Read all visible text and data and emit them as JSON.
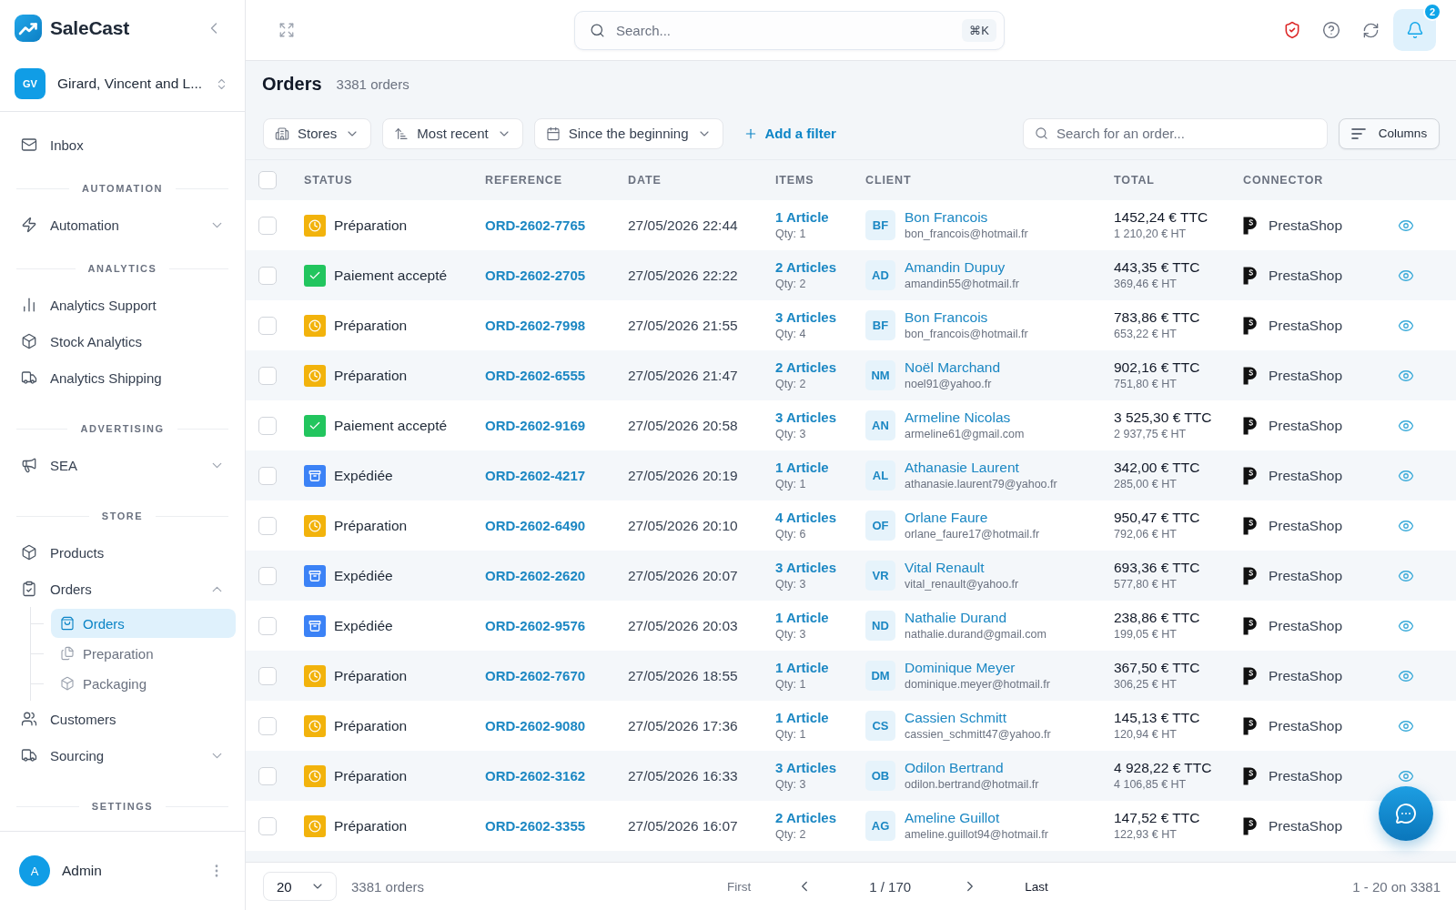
{
  "sidebar": {
    "brand": "SaleCast",
    "workspace": {
      "initials": "GV",
      "name": "Girard, Vincent and L..."
    },
    "top_items": [
      {
        "label": "Inbox",
        "selected": false
      }
    ],
    "sections": [
      {
        "title": "AUTOMATION",
        "items": [
          {
            "label": "Automation",
            "selected": false,
            "expanded": false
          }
        ]
      },
      {
        "title": "ANALYTICS",
        "items": [
          {
            "label": "Analytics Support",
            "selected": false
          },
          {
            "label": "Stock Analytics",
            "selected": false
          },
          {
            "label": "Analytics Shipping",
            "selected": false
          }
        ]
      },
      {
        "title": "ADVERTISING",
        "items": [
          {
            "label": "SEA",
            "selected": false,
            "expanded": false
          }
        ]
      },
      {
        "title": "STORE",
        "items": [
          {
            "label": "Products",
            "selected": false
          },
          {
            "label": "Orders",
            "selected": false,
            "expanded": true,
            "children": [
              {
                "label": "Orders",
                "selected": true
              },
              {
                "label": "Preparation",
                "selected": false
              },
              {
                "label": "Packaging",
                "selected": false
              }
            ]
          },
          {
            "label": "Customers",
            "selected": false
          },
          {
            "label": "Sourcing",
            "selected": false,
            "expanded": false
          }
        ]
      },
      {
        "title": "SETTINGS"
      }
    ],
    "user": {
      "initials": "A",
      "name": "Admin"
    }
  },
  "topbar": {
    "search": {
      "placeholder": "Search...",
      "shortcut": "⌘K"
    },
    "notifications": {
      "count": "2"
    }
  },
  "page": {
    "title": "Orders",
    "count": "3381 orders"
  },
  "filters": {
    "buttons": [
      {
        "label": "Stores"
      },
      {
        "label": "Most recent"
      },
      {
        "label": "Since the beginning"
      }
    ],
    "add_filter": "Add a filter",
    "search": {
      "placeholder": "Search for an order..."
    },
    "columns_button": "Columns"
  },
  "table": {
    "select_all": {
      "checked": false
    },
    "columns": [
      "STATUS",
      "REFERENCE",
      "DATE",
      "ITEMS",
      "CLIENT",
      "TOTAL",
      "CONNECTOR"
    ],
    "rows": [
      {
        "checked": false,
        "status": {
          "kind": "preparation",
          "label": "Préparation"
        },
        "reference": "ORD-2602-7765",
        "date": "27/05/2026 22:44",
        "items": "1 Article",
        "qty": "Qty: 1",
        "client": {
          "initials": "BF",
          "name": "Bon Francois",
          "email": "bon_francois@hotmail.fr"
        },
        "total_ttc": "1452,24 € TTC",
        "total_ht": "1 210,20 € HT",
        "connector": "PrestaShop"
      },
      {
        "checked": false,
        "status": {
          "kind": "paid",
          "label": "Paiement accepté"
        },
        "reference": "ORD-2602-2705",
        "date": "27/05/2026 22:22",
        "items": "2 Articles",
        "qty": "Qty: 2",
        "client": {
          "initials": "AD",
          "name": "Amandin Dupuy",
          "email": "amandin55@hotmail.fr"
        },
        "total_ttc": "443,35 € TTC",
        "total_ht": "369,46 € HT",
        "connector": "PrestaShop"
      },
      {
        "checked": false,
        "status": {
          "kind": "preparation",
          "label": "Préparation"
        },
        "reference": "ORD-2602-7998",
        "date": "27/05/2026 21:55",
        "items": "3 Articles",
        "qty": "Qty: 4",
        "client": {
          "initials": "BF",
          "name": "Bon Francois",
          "email": "bon_francois@hotmail.fr"
        },
        "total_ttc": "783,86 € TTC",
        "total_ht": "653,22 € HT",
        "connector": "PrestaShop"
      },
      {
        "checked": false,
        "status": {
          "kind": "preparation",
          "label": "Préparation"
        },
        "reference": "ORD-2602-6555",
        "date": "27/05/2026 21:47",
        "items": "2 Articles",
        "qty": "Qty: 2",
        "client": {
          "initials": "NM",
          "name": "Noël Marchand",
          "email": "noel91@yahoo.fr"
        },
        "total_ttc": "902,16 € TTC",
        "total_ht": "751,80 € HT",
        "connector": "PrestaShop"
      },
      {
        "checked": false,
        "status": {
          "kind": "paid",
          "label": "Paiement accepté"
        },
        "reference": "ORD-2602-9169",
        "date": "27/05/2026 20:58",
        "items": "3 Articles",
        "qty": "Qty: 3",
        "client": {
          "initials": "AN",
          "name": "Armeline Nicolas",
          "email": "armeline61@gmail.com"
        },
        "total_ttc": "3 525,30 € TTC",
        "total_ht": "2 937,75 € HT",
        "connector": "PrestaShop"
      },
      {
        "checked": false,
        "status": {
          "kind": "shipped",
          "label": "Expédiée"
        },
        "reference": "ORD-2602-4217",
        "date": "27/05/2026 20:19",
        "items": "1 Article",
        "qty": "Qty: 1",
        "client": {
          "initials": "AL",
          "name": "Athanasie Laurent",
          "email": "athanasie.laurent79@yahoo.fr"
        },
        "total_ttc": "342,00 € TTC",
        "total_ht": "285,00 € HT",
        "connector": "PrestaShop"
      },
      {
        "checked": false,
        "status": {
          "kind": "preparation",
          "label": "Préparation"
        },
        "reference": "ORD-2602-6490",
        "date": "27/05/2026 20:10",
        "items": "4 Articles",
        "qty": "Qty: 6",
        "client": {
          "initials": "OF",
          "name": "Orlane Faure",
          "email": "orlane_faure17@hotmail.fr"
        },
        "total_ttc": "950,47 € TTC",
        "total_ht": "792,06 € HT",
        "connector": "PrestaShop"
      },
      {
        "checked": false,
        "status": {
          "kind": "shipped",
          "label": "Expédiée"
        },
        "reference": "ORD-2602-2620",
        "date": "27/05/2026 20:07",
        "items": "3 Articles",
        "qty": "Qty: 3",
        "client": {
          "initials": "VR",
          "name": "Vital Renault",
          "email": "vital_renault@yahoo.fr"
        },
        "total_ttc": "693,36 € TTC",
        "total_ht": "577,80 € HT",
        "connector": "PrestaShop"
      },
      {
        "checked": false,
        "status": {
          "kind": "shipped",
          "label": "Expédiée"
        },
        "reference": "ORD-2602-9576",
        "date": "27/05/2026 20:03",
        "items": "1 Article",
        "qty": "Qty: 3",
        "client": {
          "initials": "ND",
          "name": "Nathalie Durand",
          "email": "nathalie.durand@gmail.com"
        },
        "total_ttc": "238,86 € TTC",
        "total_ht": "199,05 € HT",
        "connector": "PrestaShop"
      },
      {
        "checked": false,
        "status": {
          "kind": "preparation",
          "label": "Préparation"
        },
        "reference": "ORD-2602-7670",
        "date": "27/05/2026 18:55",
        "items": "1 Article",
        "qty": "Qty: 1",
        "client": {
          "initials": "DM",
          "name": "Dominique Meyer",
          "email": "dominique.meyer@hotmail.fr"
        },
        "total_ttc": "367,50 € TTC",
        "total_ht": "306,25 € HT",
        "connector": "PrestaShop"
      },
      {
        "checked": false,
        "status": {
          "kind": "preparation",
          "label": "Préparation"
        },
        "reference": "ORD-2602-9080",
        "date": "27/05/2026 17:36",
        "items": "1 Article",
        "qty": "Qty: 1",
        "client": {
          "initials": "CS",
          "name": "Cassien Schmitt",
          "email": "cassien_schmitt47@yahoo.fr"
        },
        "total_ttc": "145,13 € TTC",
        "total_ht": "120,94 € HT",
        "connector": "PrestaShop"
      },
      {
        "checked": false,
        "status": {
          "kind": "preparation",
          "label": "Préparation"
        },
        "reference": "ORD-2602-3162",
        "date": "27/05/2026 16:33",
        "items": "3 Articles",
        "qty": "Qty: 3",
        "client": {
          "initials": "OB",
          "name": "Odilon Bertrand",
          "email": "odilon.bertrand@hotmail.fr"
        },
        "total_ttc": "4 928,22 € TTC",
        "total_ht": "4 106,85 € HT",
        "connector": "PrestaShop"
      },
      {
        "checked": false,
        "status": {
          "kind": "preparation",
          "label": "Préparation"
        },
        "reference": "ORD-2602-3355",
        "date": "27/05/2026 16:07",
        "items": "2 Articles",
        "qty": "Qty: 2",
        "client": {
          "initials": "AG",
          "name": "Ameline Guillot",
          "email": "ameline.guillot94@hotmail.fr"
        },
        "total_ttc": "147,52 € TTC",
        "total_ht": "122,93 € HT",
        "connector": "PrestaShop"
      }
    ]
  },
  "footer": {
    "page_size": "20",
    "count": "3381 orders",
    "first": "First",
    "page": "1 / 170",
    "last": "Last",
    "range": "1 - 20 on 3381"
  }
}
